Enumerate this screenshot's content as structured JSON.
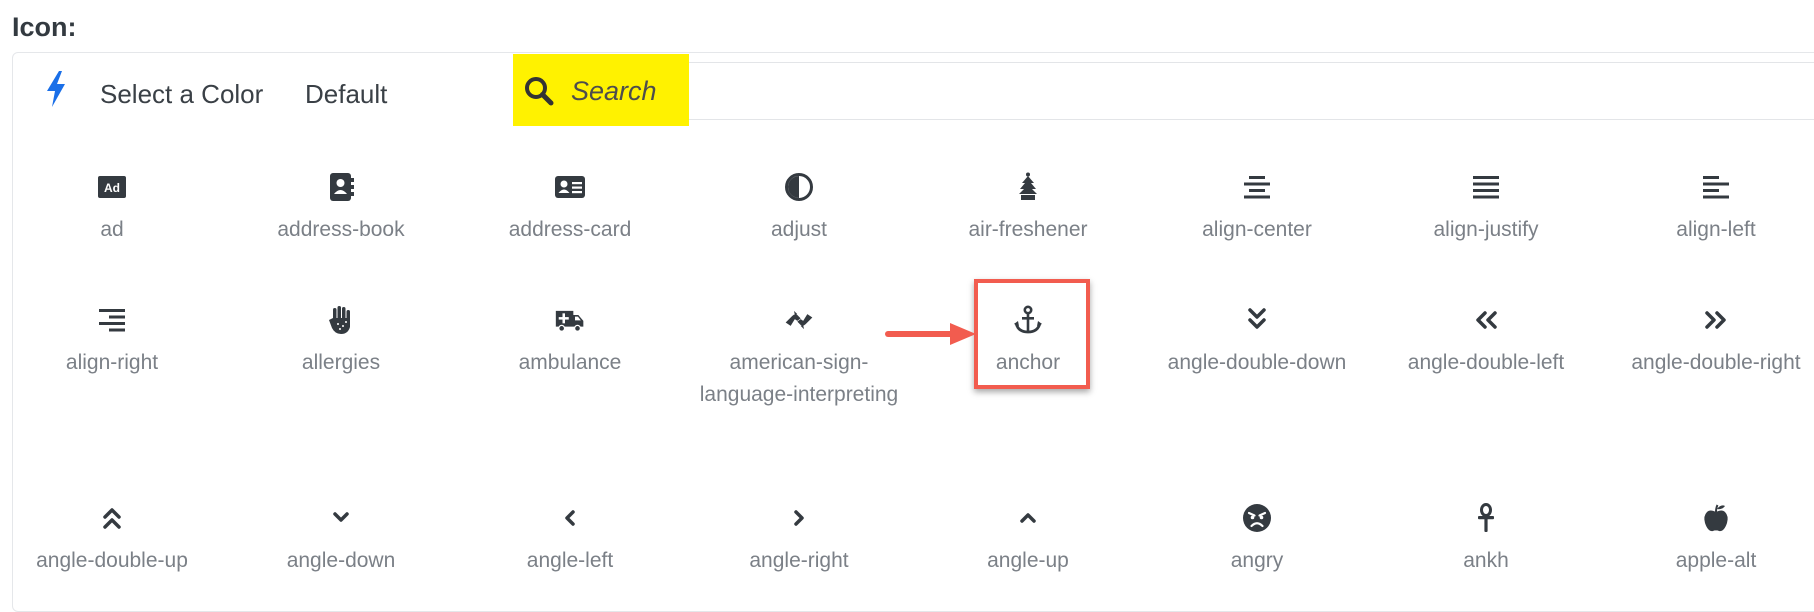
{
  "field_label": "Icon:",
  "toolbar": {
    "select_color_label": "Select a Color",
    "default_label": "Default",
    "search_placeholder": "Search"
  },
  "colors": {
    "accent": "#1a6fe8",
    "highlight": "#fff200",
    "annotation": "#f25c4f",
    "icon": "#343a40"
  },
  "icons": [
    {
      "label": "ad",
      "icon": "ad-icon"
    },
    {
      "label": "address-book",
      "icon": "address-book-icon"
    },
    {
      "label": "address-card",
      "icon": "address-card-icon"
    },
    {
      "label": "adjust",
      "icon": "adjust-icon"
    },
    {
      "label": "air-freshener",
      "icon": "air-freshener-icon"
    },
    {
      "label": "align-center",
      "icon": "align-center-icon"
    },
    {
      "label": "align-justify",
      "icon": "align-justify-icon"
    },
    {
      "label": "align-left",
      "icon": "align-left-icon"
    },
    {
      "label": "align-right",
      "icon": "align-right-icon"
    },
    {
      "label": "allergies",
      "icon": "allergies-icon"
    },
    {
      "label": "ambulance",
      "icon": "ambulance-icon"
    },
    {
      "label": "american-sign-language-interpreting",
      "icon": "american-sign-language-interpreting-icon"
    },
    {
      "label": "anchor",
      "icon": "anchor-icon"
    },
    {
      "label": "angle-double-down",
      "icon": "angle-double-down-icon"
    },
    {
      "label": "angle-double-left",
      "icon": "angle-double-left-icon"
    },
    {
      "label": "angle-double-right",
      "icon": "angle-double-right-icon"
    },
    {
      "label": "angle-double-up",
      "icon": "angle-double-up-icon"
    },
    {
      "label": "angle-down",
      "icon": "angle-down-icon"
    },
    {
      "label": "angle-left",
      "icon": "angle-left-icon"
    },
    {
      "label": "angle-right",
      "icon": "angle-right-icon"
    },
    {
      "label": "angle-up",
      "icon": "angle-up-icon"
    },
    {
      "label": "angry",
      "icon": "angry-icon"
    },
    {
      "label": "ankh",
      "icon": "ankh-icon"
    },
    {
      "label": "apple-alt",
      "icon": "apple-alt-icon"
    }
  ]
}
